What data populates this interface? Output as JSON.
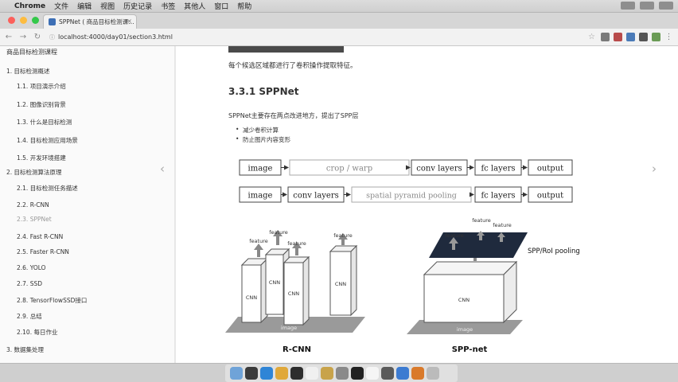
{
  "menubar": {
    "app": "Chrome",
    "items": [
      "文件",
      "编辑",
      "视图",
      "历史记录",
      "书签",
      "其他人",
      "窗口",
      "帮助"
    ]
  },
  "tab": {
    "title": "SPPNet ( 商品目标检测课… "
  },
  "address": {
    "url": "localhost:4000/day01/section3.html"
  },
  "sidebar": {
    "title": "商品目标检测课程",
    "items": [
      {
        "label": "1. 目标检测概述"
      },
      {
        "label": "1.1. 项目演示介绍"
      },
      {
        "label": "1.2. 图像识别背景"
      },
      {
        "label": "1.3. 什么是目标检测"
      },
      {
        "label": "1.4. 目标检测应用场景"
      },
      {
        "label": "1.5. 开发环境搭建"
      },
      {
        "label": "2. 目标检测算法原理"
      },
      {
        "label": "2.1. 目标检测任务描述"
      },
      {
        "label": "2.2. R-CNN"
      },
      {
        "label": "2.3. SPPNet"
      },
      {
        "label": "2.4. Fast R-CNN"
      },
      {
        "label": "2.5. Faster R-CNN"
      },
      {
        "label": "2.6. YOLO"
      },
      {
        "label": "2.7. SSD"
      },
      {
        "label": "2.8. TensorFlowSSD接口"
      },
      {
        "label": "2.9. 总结"
      },
      {
        "label": "2.10. 每日作业"
      },
      {
        "label": "3. 数据集处理"
      }
    ]
  },
  "content": {
    "para1": "每个候选区域都进行了卷积操作提取特征。",
    "heading": "3.3.1 SPPNet",
    "para2": "SPPNet主要存在两点改进地方，提出了SPP层",
    "bullets": [
      "减少卷积计算",
      "防止图片内容变形"
    ],
    "diagram": {
      "row1": [
        "image",
        "crop / warp",
        "conv layers",
        "fc layers",
        "output"
      ],
      "row2": [
        "image",
        "conv layers",
        "spatial pyramid pooling",
        "fc layers",
        "output"
      ],
      "left_caption": "R-CNN",
      "right_caption": "SPP-net",
      "cnn_label": "CNN",
      "feature_label": "feature",
      "image_label": "image",
      "spp_label": "SPP/RoI pooling"
    }
  }
}
